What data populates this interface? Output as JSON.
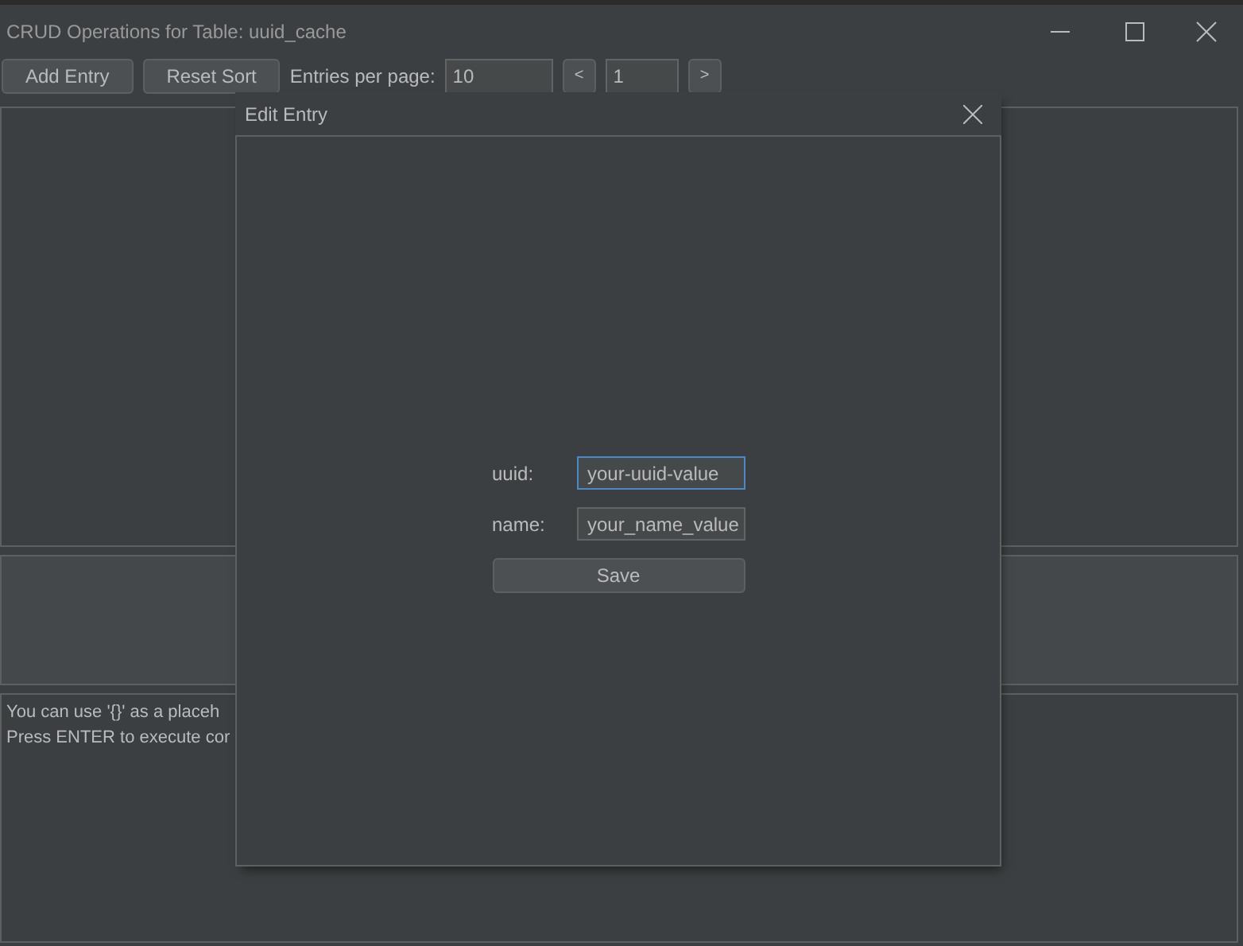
{
  "window": {
    "title": "CRUD Operations for Table: uuid_cache"
  },
  "toolbar": {
    "buttons": [
      "Add Entry",
      "Reset Sort"
    ],
    "entries_label": "Entries per page:",
    "entries_value": "10",
    "prev": "<",
    "page_value": "1",
    "next": ">"
  },
  "console": {
    "lines": [
      "You can use '{}' as a placeh",
      "Press ENTER to execute cor"
    ]
  },
  "dialog": {
    "title": "Edit Entry",
    "fields": [
      {
        "label": "uuid:",
        "value": "your-uuid-value",
        "focused": true
      },
      {
        "label": "name:",
        "value": "your_name_value",
        "focused": false
      }
    ],
    "button": "Save"
  }
}
